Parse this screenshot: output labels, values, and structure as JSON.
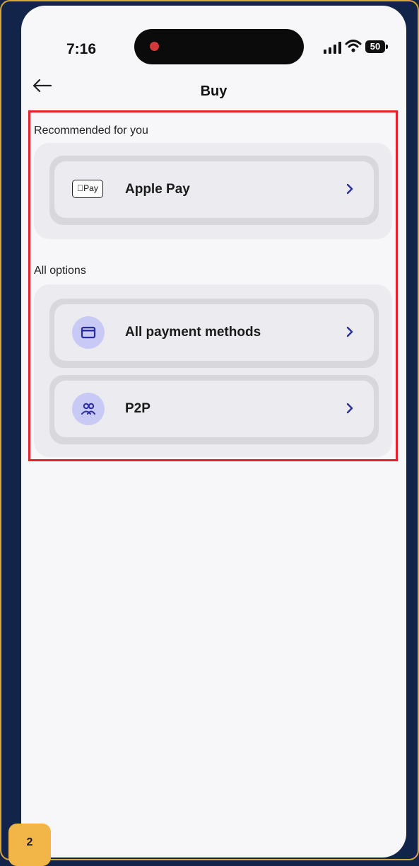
{
  "status_bar": {
    "time": "7:16",
    "battery": "50"
  },
  "header": {
    "title": "Buy"
  },
  "recommended": {
    "label": "Recommended for you",
    "items": [
      {
        "badge": "Pay",
        "label": "Apple Pay"
      }
    ]
  },
  "all_options": {
    "label": "All options",
    "items": [
      {
        "label": "All payment methods",
        "icon": "wallet-icon"
      },
      {
        "label": "P2P",
        "icon": "users-icon"
      }
    ]
  },
  "step_badge": "2",
  "colors": {
    "accent_chevron": "#2a2d9e",
    "highlight": "#e3202c",
    "icon_bg": "#c9c9f6",
    "step_badge": "#f2b547"
  }
}
